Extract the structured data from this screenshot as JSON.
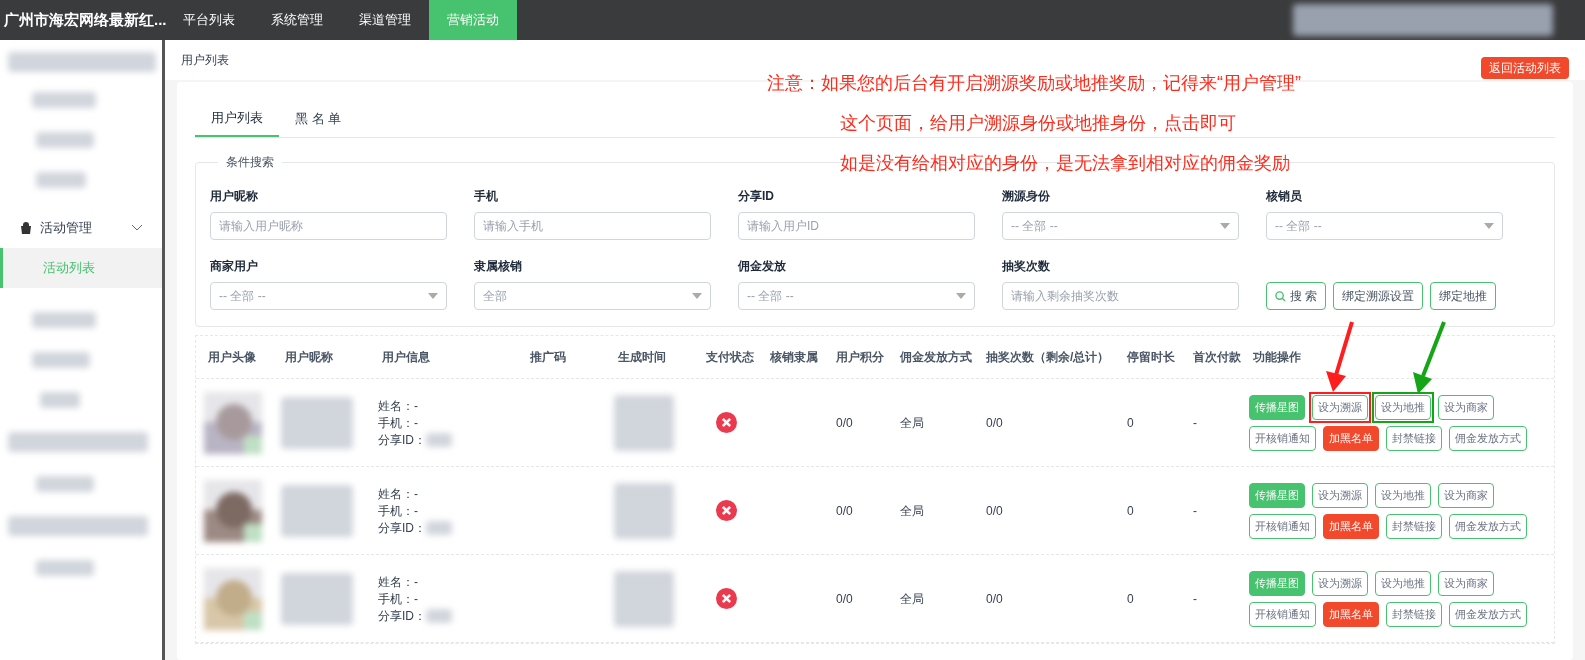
{
  "brand": "广州市海宏网络最新红...",
  "nav": [
    {
      "label": "平台列表",
      "selected": false
    },
    {
      "label": "系统管理",
      "selected": false
    },
    {
      "label": "渠道管理",
      "selected": false
    },
    {
      "label": "营销活动",
      "selected": true
    }
  ],
  "sidebar": {
    "group": {
      "label": "活动管理",
      "expanded": true,
      "children": [
        {
          "label": "活动列表",
          "selected": true
        }
      ]
    }
  },
  "breadcrumb": "用户列表",
  "back_button": "返回活动列表",
  "annotation": [
    "注意：如果您的后台有开启溯源奖励或地推奖励，记得来“用户管理”",
    "这个页面，给用户溯源身份或地推身份，点击即可",
    "如是没有给相对应的身份，是无法拿到相对应的佣金奖励"
  ],
  "tabs": [
    {
      "label": "用户列表",
      "selected": true
    },
    {
      "label": "黑 名 单",
      "selected": false
    }
  ],
  "search": {
    "legend": "条件搜索",
    "fields": [
      {
        "label": "用户昵称",
        "kind": "input",
        "placeholder": "请输入用户昵称"
      },
      {
        "label": "手机",
        "kind": "input",
        "placeholder": "请输入手机"
      },
      {
        "label": "分享ID",
        "kind": "input",
        "placeholder": "请输入用户ID"
      },
      {
        "label": "溯源身份",
        "kind": "select",
        "value": "-- 全部 --"
      },
      {
        "label": "核销员",
        "kind": "select",
        "value": "-- 全部 --"
      },
      {
        "label": "商家用户",
        "kind": "select",
        "value": "-- 全部 --"
      },
      {
        "label": "隶属核销",
        "kind": "select",
        "value": "全部"
      },
      {
        "label": "佣金发放",
        "kind": "select",
        "value": "-- 全部 --"
      },
      {
        "label": "抽奖次数",
        "kind": "input",
        "placeholder": "请输入剩余抽奖次数"
      }
    ],
    "buttons": [
      "搜 索",
      "绑定溯源设置",
      "绑定地推"
    ]
  },
  "table": {
    "columns": [
      "用户头像",
      "用户昵称",
      "用户信息",
      "推广码",
      "生成时间",
      "支付状态",
      "核销隶属",
      "用户积分",
      "佣金发放方式",
      "抽奖次数（剩余/总计）",
      "停留时长",
      "首次付款",
      "功能操作"
    ],
    "rows": [
      {
        "info": [
          "姓名：-",
          "手机：-",
          "分享ID："
        ],
        "paid": false,
        "points": "0/0",
        "commission": "全局",
        "draws": "0/0",
        "stay": "0",
        "first_pay": "-",
        "actions": [
          {
            "label": "传播星图",
            "kind": "primary"
          },
          {
            "label": "设为溯源",
            "kind": "outline",
            "color": "#ff1e1e"
          },
          {
            "label": "设为地推",
            "kind": "outline",
            "color": "#16a516"
          },
          {
            "label": "设为商家",
            "kind": "outline"
          },
          {
            "label": "开核销通知",
            "kind": "outline"
          },
          {
            "label": "加黑名单",
            "kind": "danger"
          },
          {
            "label": "封禁链接",
            "kind": "outline"
          },
          {
            "label": "佣金发放方式",
            "kind": "outline"
          }
        ]
      },
      {
        "info": [
          "姓名：-",
          "手机：-",
          "分享ID："
        ],
        "paid": false,
        "points": "0/0",
        "commission": "全局",
        "draws": "0/0",
        "stay": "0",
        "first_pay": "-",
        "actions": [
          {
            "label": "传播星图",
            "kind": "primary"
          },
          {
            "label": "设为溯源",
            "kind": "outline"
          },
          {
            "label": "设为地推",
            "kind": "outline"
          },
          {
            "label": "设为商家",
            "kind": "outline"
          },
          {
            "label": "开核销通知",
            "kind": "outline"
          },
          {
            "label": "加黑名单",
            "kind": "danger"
          },
          {
            "label": "封禁链接",
            "kind": "outline"
          },
          {
            "label": "佣金发放方式",
            "kind": "outline"
          }
        ]
      },
      {
        "info": [
          "姓名：-",
          "手机：-",
          "分享ID："
        ],
        "paid": false,
        "points": "0/0",
        "commission": "全局",
        "draws": "0/0",
        "stay": "0",
        "first_pay": "-",
        "actions": [
          {
            "label": "传播星图",
            "kind": "primary"
          },
          {
            "label": "设为溯源",
            "kind": "outline"
          },
          {
            "label": "设为地推",
            "kind": "outline"
          },
          {
            "label": "设为商家",
            "kind": "outline"
          },
          {
            "label": "开核销通知",
            "kind": "outline"
          },
          {
            "label": "加黑名单",
            "kind": "danger"
          },
          {
            "label": "封禁链接",
            "kind": "outline"
          },
          {
            "label": "佣金发放方式",
            "kind": "outline"
          }
        ]
      }
    ]
  }
}
